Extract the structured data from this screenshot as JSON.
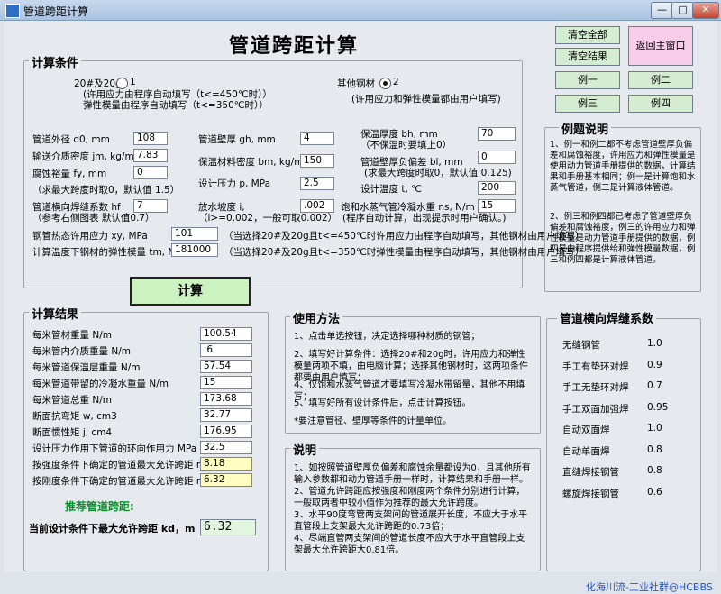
{
  "window": {
    "title": "管道跨距计算",
    "min": "—",
    "max": "□",
    "close": "✕"
  },
  "header": {
    "title": "管道跨距计算"
  },
  "buttons": {
    "clear_all": "清空全部",
    "clear_result": "清空结果",
    "back_home": "返回主窗口",
    "ex1": "例一",
    "ex2": "例二",
    "ex3": "例三",
    "ex4": "例四",
    "calc": "计算"
  },
  "conditions": {
    "title": "计算条件",
    "material1": "20#及20g",
    "material1_num": "1",
    "material1_note1": "(许用应力由程序自动填写（t<=450℃时））",
    "material1_note2": "弹性模量由程序自动填写（t<=350℃时））",
    "material2": "其他钢材",
    "material2_num": "2",
    "material2_note": "(许用应力和弹性模量都由用户填写)",
    "selected": 2,
    "d0_label": "管道外径 d0, mm",
    "d0": "108",
    "gh_label": "管道壁厚 gh, mm",
    "gh": "4",
    "bh_label": "保温厚度 bh, mm",
    "bh": "70",
    "bh_note": "（不保温时要填上0）",
    "jm_label": "输送介质密度 jm, kg/m3",
    "jm": "7.83",
    "bm_label": "保温材料密度 bm, kg/m3",
    "bm": "150",
    "bl_label": "管道壁厚负偏差 bl, mm",
    "bl": "0",
    "bl_note": "(求最大跨度时取0，默认值 0.125)",
    "fy_label": "腐蚀裕量 fy, mm",
    "fy": "0",
    "fy_note": "（求最大跨度时取0，默认值 1.5）",
    "p_label": "设计压力 p, MPa",
    "p": "2.5",
    "t_label": "设计温度 t, ℃",
    "t": "200",
    "hf_label": "管道横向焊缝系数 hf",
    "hf": "7",
    "hf_note": "（参考右侧图表 默认值0.7）",
    "i_label": "放水坡度 i,",
    "i": ".002",
    "i_note": "（i>=0.002，一般可取0.002）",
    "ns_label": "饱和水蒸气管冷凝水重 ns, N/m",
    "ns": "15",
    "ns_note": "(程序自动计算，出现提示时用户确认。)",
    "xy_label": "钢管热态许用应力 xy, MPa",
    "xy": "101",
    "xy_note": "（当选择20#及20g且t<=450℃时许用应力由程序自动填写，其他钢材由用户填写）",
    "tm_label": "计算温度下钢材的弹性模量 tm, MPa",
    "tm": "181000",
    "tm_note": "（当选择20#及20g且t<=350℃时弹性模量由程序自动填写，其他钢材由用户填写）"
  },
  "results": {
    "title": "计算结果",
    "rows": [
      {
        "label": "每米管材重量 N/m",
        "value": "100.54"
      },
      {
        "label": "每米管内介质重量 N/m",
        "value": ".6"
      },
      {
        "label": "每米管道保温层重量 N/m",
        "value": "57.54"
      },
      {
        "label": "每米管道带留的冷凝水重量 N/m",
        "value": "15"
      },
      {
        "label": "每米管道总重 N/m",
        "value": "173.68"
      },
      {
        "label": "断面抗弯矩 w, cm3",
        "value": "32.77"
      },
      {
        "label": "断面惯性矩 j, cm4",
        "value": "176.95"
      },
      {
        "label": "设计压力作用下管道的环向作用力 MPa",
        "value": "32.5"
      },
      {
        "label": "按强度条件下确定的管道最大允许跨距 m",
        "value": "8.18"
      },
      {
        "label": "按刚度条件下确定的管道最大允许跨距 m",
        "value": "6.32"
      }
    ],
    "recommend": "推荐管道跨距:",
    "final_label": "当前设计条件下最大允许跨距 kd，m",
    "final_value": "6.32"
  },
  "usage": {
    "title": "使用方法",
    "items": [
      "1、点击单选按钮，决定选择哪种材质的钢管；",
      "2、填写好计算条件：选择20#和20g时，许用应力和弹性模量两项不填，由电脑计算；选择其他钢材时，这两项条件都要由用户填写；",
      "4、仅饱和水蒸气管道才要填写冷凝水带留量，其他不用填写；",
      "5、填写好所有设计条件后，点击计算按钮。",
      "*要注意管径、壁厚等条件的计量单位。"
    ]
  },
  "notes": {
    "title": "说明",
    "items": [
      "1、如按照管道壁厚负偏差和腐蚀余量都设为0，且其他所有输入参数都和动力管道手册一样时，计算结果和手册一样。",
      "2、管道允许跨距应按强度和刚度两个条件分别进行计算，一般取两者中较小值作为推荐的最大允许跨度。",
      "3、水平90度弯管两支架间的管道展开长度，不应大于水平直管段上支架最大允许跨距的0.73倍；",
      "4、尽端直管两支架间的管道长度不应大于水平直管段上支架最大允许跨距大0.81倍。"
    ]
  },
  "example_desc": {
    "title": "例题说明",
    "p1": "1、例一和例二都不考虑管道壁厚负偏差和腐蚀裕度，许用应力和弹性模量是使用动力管道手册提供的数据，计算结果和手册基本相同；例一是计算饱和水蒸气管道，例二是计算液体管道。",
    "p2": "2、例三和例四都已考虑了管道壁厚负偏差和腐蚀裕度，例三的许用应力和弹性模量是动力管道手册提供的数据，例四是由程序提供给和弹性模量数据，例三和例四都是计算液体管道。"
  },
  "weld_table": {
    "title": "管道横向焊缝系数",
    "rows": [
      {
        "name": "无缝钢管",
        "value": "1.0"
      },
      {
        "name": "手工有垫环对焊",
        "value": "0.9"
      },
      {
        "name": "手工无垫环对焊",
        "value": "0.7"
      },
      {
        "name": "手工双面加强焊",
        "value": "0.95"
      },
      {
        "name": "自动双面焊",
        "value": "1.0"
      },
      {
        "name": "自动单面焊",
        "value": "0.8"
      },
      {
        "name": "直缝焊接钢管",
        "value": "0.8"
      },
      {
        "name": "螺旋焊接钢管",
        "value": "0.6"
      }
    ]
  },
  "watermark": "化海川流-工业社群@HCBBS"
}
